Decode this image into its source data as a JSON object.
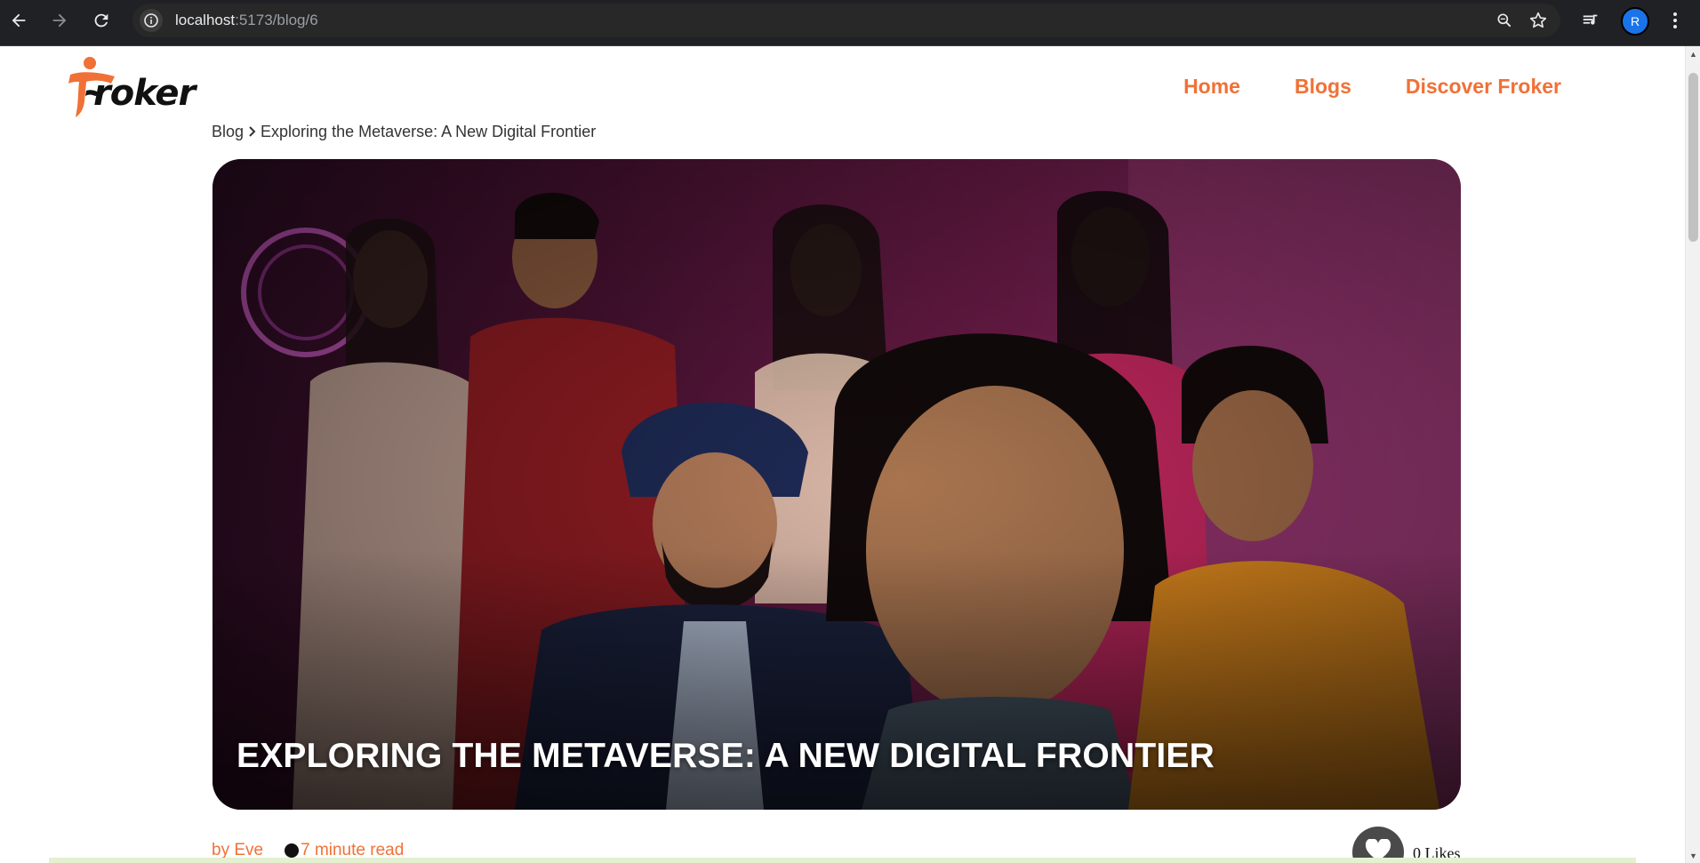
{
  "browser": {
    "url_host": "localhost",
    "url_path": ":5173/blog/6",
    "profile_initial": "R"
  },
  "site": {
    "logo_text": "roker",
    "nav": [
      "Home",
      "Blogs",
      "Discover Froker"
    ]
  },
  "breadcrumb": {
    "root": "Blog",
    "current": "Exploring the Metaverse: A New Digital Frontier"
  },
  "post": {
    "title": "Exploring the Metaverse: A New Digital Frontier",
    "author": "by Eve",
    "read_time": "7 minute read",
    "likes": "0 Likes"
  },
  "colors": {
    "accent": "#f07137",
    "chrome_bg": "#202124"
  }
}
